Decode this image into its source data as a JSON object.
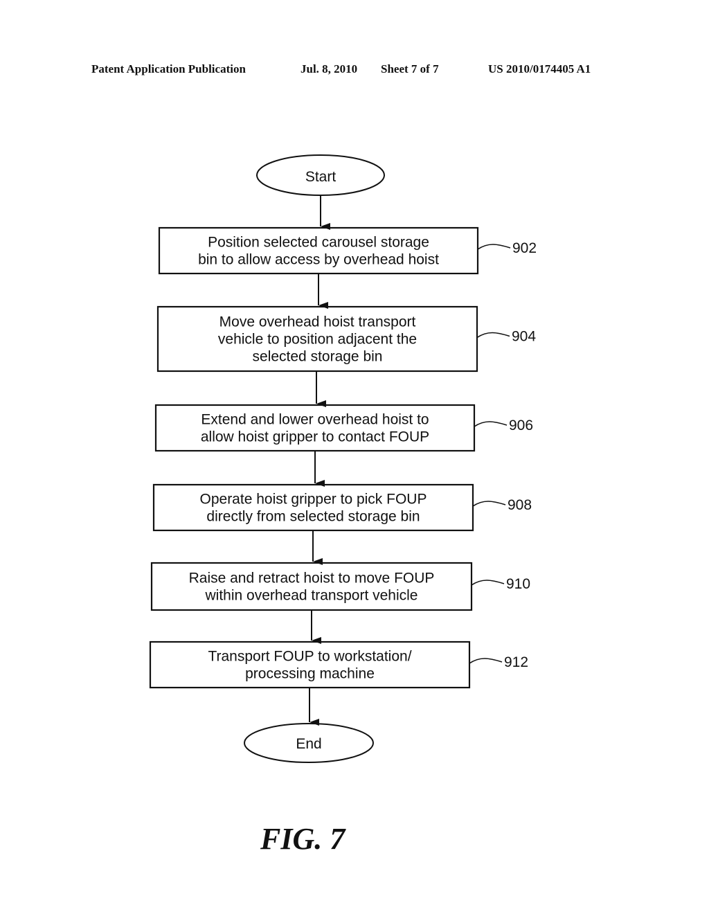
{
  "header": {
    "publication": "Patent Application Publication",
    "date": "Jul. 8, 2010",
    "sheet": "Sheet 7 of 7",
    "patent_number": "US 2010/0174405 A1"
  },
  "flowchart": {
    "start": "Start",
    "end": "End",
    "steps": [
      {
        "ref": "902",
        "lines": [
          "Position selected carousel storage",
          "bin to allow access by overhead hoist"
        ]
      },
      {
        "ref": "904",
        "lines": [
          "Move overhead hoist transport",
          "vehicle to position adjacent the",
          "selected storage bin"
        ]
      },
      {
        "ref": "906",
        "lines": [
          "Extend and lower overhead hoist to",
          "allow hoist gripper to contact FOUP"
        ]
      },
      {
        "ref": "908",
        "lines": [
          "Operate hoist gripper to pick FOUP",
          "directly from selected storage bin"
        ]
      },
      {
        "ref": "910",
        "lines": [
          "Raise and retract hoist to move FOUP",
          "within overhead transport vehicle"
        ]
      },
      {
        "ref": "912",
        "lines": [
          "Transport FOUP to workstation/",
          "processing machine"
        ]
      }
    ]
  },
  "figure_label": "FIG. 7"
}
